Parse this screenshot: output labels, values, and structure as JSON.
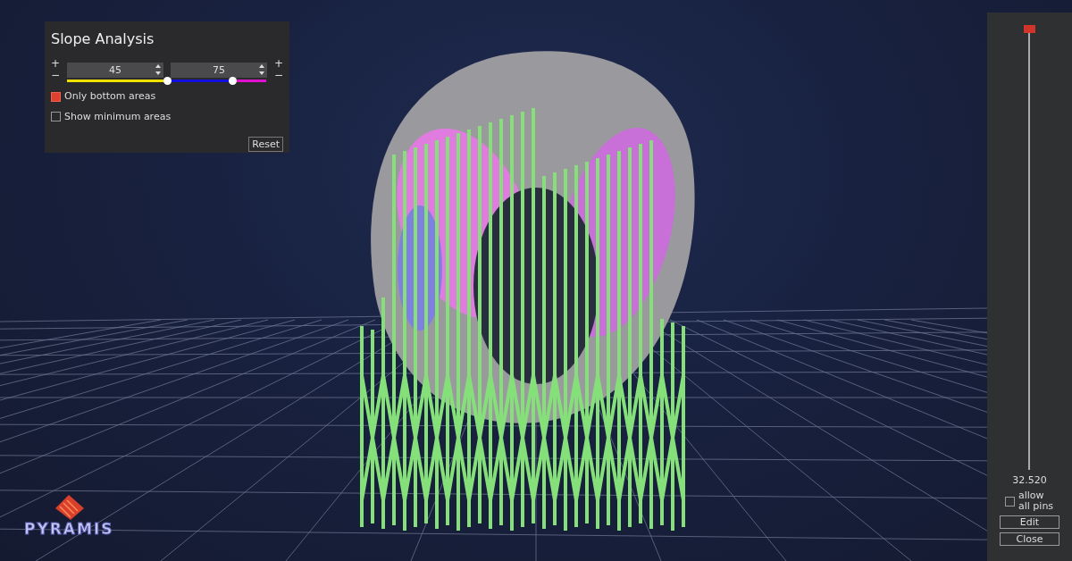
{
  "slope_panel": {
    "title": "Slope Analysis",
    "left_steppers": [
      "+",
      "−"
    ],
    "inputs": [
      {
        "value": "45"
      },
      {
        "value": "75"
      }
    ],
    "right_steppers": [
      "+",
      "−"
    ],
    "thumbs": [
      {
        "level": 0.5
      },
      {
        "level": 0.83
      }
    ],
    "checkboxes": [
      {
        "label": "Only bottom areas",
        "checked": true
      },
      {
        "label": "Show minimum areas",
        "checked": false
      }
    ],
    "reset_button": "Reset"
  },
  "height_panel": {
    "slider": {
      "level": 1
    },
    "value": "32.520",
    "allow_pins": {
      "label": "allow all pins",
      "checked": false
    },
    "buttons": [
      "Edit",
      "Close"
    ]
  },
  "logo": {
    "text": "PYRAMIS"
  }
}
